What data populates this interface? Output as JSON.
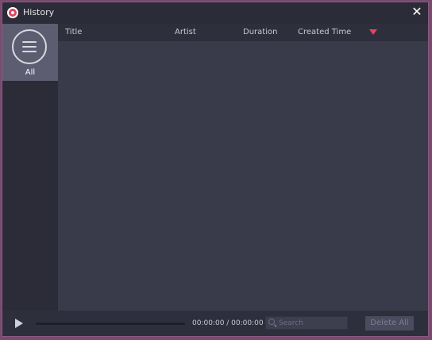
{
  "window": {
    "title": "History",
    "close_glyph": "✕",
    "icon": "record-icon"
  },
  "sidebar": {
    "items": [
      {
        "label": "All",
        "icon": "list-icon",
        "selected": true
      }
    ]
  },
  "table": {
    "columns": [
      "Title",
      "Artist",
      "Duration",
      "Created Time"
    ],
    "sort_indicator": "descending",
    "rows": []
  },
  "player": {
    "time": "00:00:00 / 00:00:00",
    "progress": 0
  },
  "search": {
    "placeholder": "Search",
    "value": ""
  },
  "actions": {
    "delete_all_label": "Delete All"
  },
  "colors": {
    "accent": "#e2455c",
    "background": "#393a4a",
    "panel": "#2b2c38",
    "selected": "#5c5d70"
  }
}
